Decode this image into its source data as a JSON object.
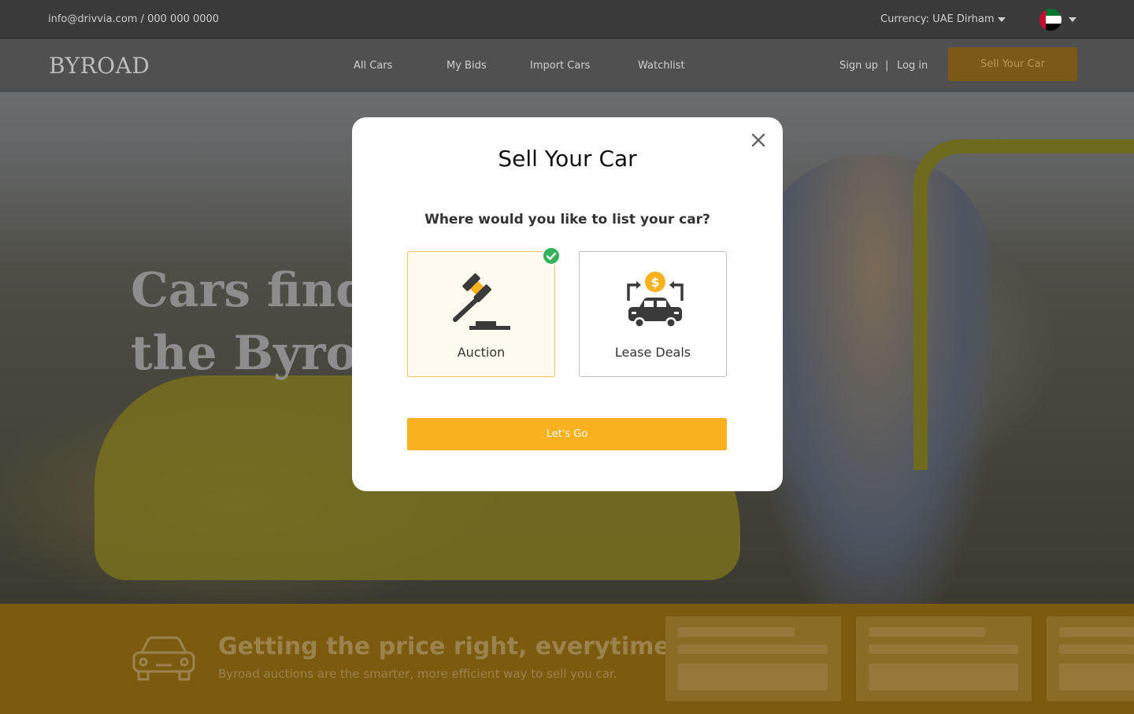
{
  "topbar": {
    "contact": "info@drivvia.com / 000 000 0000",
    "currency": "Currency: UAE Dirham",
    "flag_colors": {
      "red": "#c8102e",
      "green": "#00732f",
      "white": "#ffffff",
      "black": "#000000"
    }
  },
  "header": {
    "logo": "BYROAD",
    "nav": [
      "All Cars",
      "My Bids",
      "Import Cars",
      "Watchlist"
    ],
    "signup": "Sign up",
    "separator": "|",
    "login": "Log in",
    "sell_button": "Sell Your Car"
  },
  "hero": {
    "headline_line1": "Cars find",
    "headline_line2": "the Byroa"
  },
  "band": {
    "title": "Getting the price right, everytime.",
    "subtitle": "Byroad auctions are the smarter, more efficient way to sell you car."
  },
  "modal": {
    "title": "Sell Your Car",
    "question": "Where would you like to list your car?",
    "options": [
      {
        "label": "Auction",
        "icon": "gavel-icon",
        "selected": true
      },
      {
        "label": "Lease Deals",
        "icon": "car-dollar-exchange-icon",
        "selected": false
      }
    ],
    "button": "Let's Go"
  },
  "colors": {
    "accent": "#f9b11d",
    "check": "#35b35a",
    "selected_border": "#f2c263",
    "icon_dark": "#3a3a3a"
  }
}
